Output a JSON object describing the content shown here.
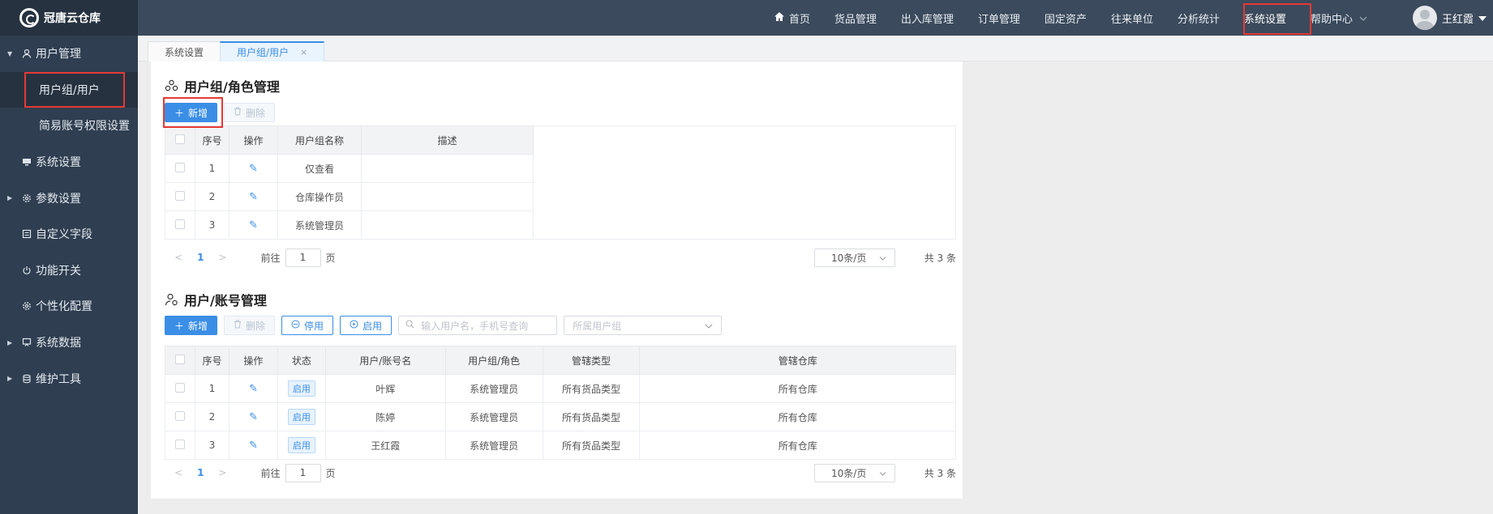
{
  "app": {
    "name": "冠唐云仓库"
  },
  "sidebar": {
    "items": [
      {
        "label": "用户管理",
        "icon": "user-icon",
        "caret": "▼"
      },
      {
        "label": "用户组/用户",
        "sub": true
      },
      {
        "label": "简易账号权限设置",
        "sub": true
      },
      {
        "label": "系统设置",
        "icon": "monitor-icon"
      },
      {
        "label": "参数设置",
        "icon": "gear-icon",
        "caret": "▶"
      },
      {
        "label": "自定义字段",
        "icon": "form-icon"
      },
      {
        "label": "功能开关",
        "icon": "power-icon"
      },
      {
        "label": "个性化配置",
        "icon": "gear-icon"
      },
      {
        "label": "系统数据",
        "icon": "chart-board-icon",
        "caret": "▶"
      },
      {
        "label": "维护工具",
        "icon": "database-icon",
        "caret": "▶"
      }
    ]
  },
  "topnav": {
    "items": [
      "首页",
      "货品管理",
      "出入库管理",
      "订单管理",
      "固定资产",
      "往来单位",
      "分析统计",
      "系统设置",
      "帮助中心"
    ],
    "user": "王红霞"
  },
  "tabs": [
    {
      "label": "系统设置"
    },
    {
      "label": "用户组/用户",
      "close": "×"
    }
  ],
  "groups": {
    "title": "用户组/角色管理",
    "add_label": "新增",
    "delete_label": "删除",
    "columns": [
      "",
      "序号",
      "操作",
      "用户组名称",
      "描述"
    ],
    "rows": [
      {
        "no": "1",
        "name": "仅查看",
        "desc": ""
      },
      {
        "no": "2",
        "name": "仓库操作员",
        "desc": ""
      },
      {
        "no": "3",
        "name": "系统管理员",
        "desc": ""
      }
    ],
    "pager": {
      "page": "1",
      "goto_label": "前往",
      "goto_value": "1",
      "page_suffix": "页",
      "size": "10条/页",
      "total": "共 3 条"
    }
  },
  "users": {
    "title": "用户/账号管理",
    "add_label": "新增",
    "delete_label": "删除",
    "disable_label": "停用",
    "enable_label": "启用",
    "search_placeholder": "输入用户名，手机号查询",
    "group_placeholder": "所属用户组",
    "columns": [
      "",
      "序号",
      "操作",
      "状态",
      "用户/账号名",
      "用户组/角色",
      "管辖类型",
      "管辖仓库"
    ],
    "rows": [
      {
        "no": "1",
        "status": "启用",
        "name": "叶辉",
        "role": "系统管理员",
        "type": "所有货品类型",
        "warehouse": "所有仓库"
      },
      {
        "no": "2",
        "status": "启用",
        "name": "陈婷",
        "role": "系统管理员",
        "type": "所有货品类型",
        "warehouse": "所有仓库"
      },
      {
        "no": "3",
        "status": "启用",
        "name": "王红霞",
        "role": "系统管理员",
        "type": "所有货品类型",
        "warehouse": "所有仓库"
      }
    ],
    "pager": {
      "page": "1",
      "goto_label": "前往",
      "goto_value": "1",
      "page_suffix": "页",
      "size": "10条/页",
      "total": "共 3 条"
    }
  },
  "colors": {
    "accent": "#3a8ee6",
    "sidebar": "#2f3e50",
    "topbar": "#3b4a5c",
    "highlight": "#e53935"
  }
}
